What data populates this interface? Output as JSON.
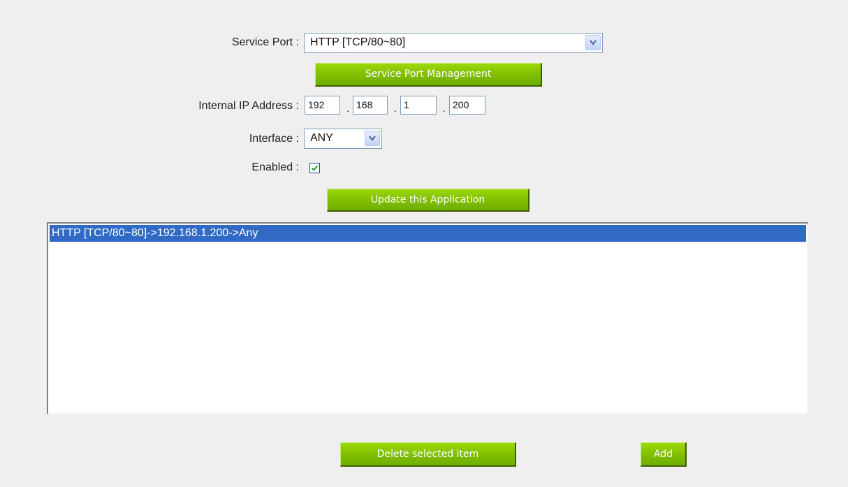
{
  "form": {
    "service_port": {
      "label": "Service Port :",
      "selected": "HTTP [TCP/80~80]"
    },
    "service_port_management_label": "Service Port Management",
    "internal_ip": {
      "label": "Internal IP Address :",
      "octets": [
        "192",
        "168",
        "1",
        "200"
      ],
      "separator": "."
    },
    "interface": {
      "label": "Interface :",
      "selected": "ANY"
    },
    "enabled": {
      "label": "Enabled :",
      "checked": true
    },
    "update_label": "Update this Application"
  },
  "list": {
    "items": [
      "HTTP [TCP/80~80]->192.168.1.200->Any"
    ],
    "selected_index": 0,
    "selected_bg": "#316ac5"
  },
  "actions": {
    "delete_label": "Delete selected item",
    "add_label": "Add"
  },
  "colors": {
    "button_green": "#7fbd00",
    "page_bg": "#efefef"
  },
  "icons": {
    "dropdown": "chevron-down-icon",
    "check": "check-icon"
  }
}
